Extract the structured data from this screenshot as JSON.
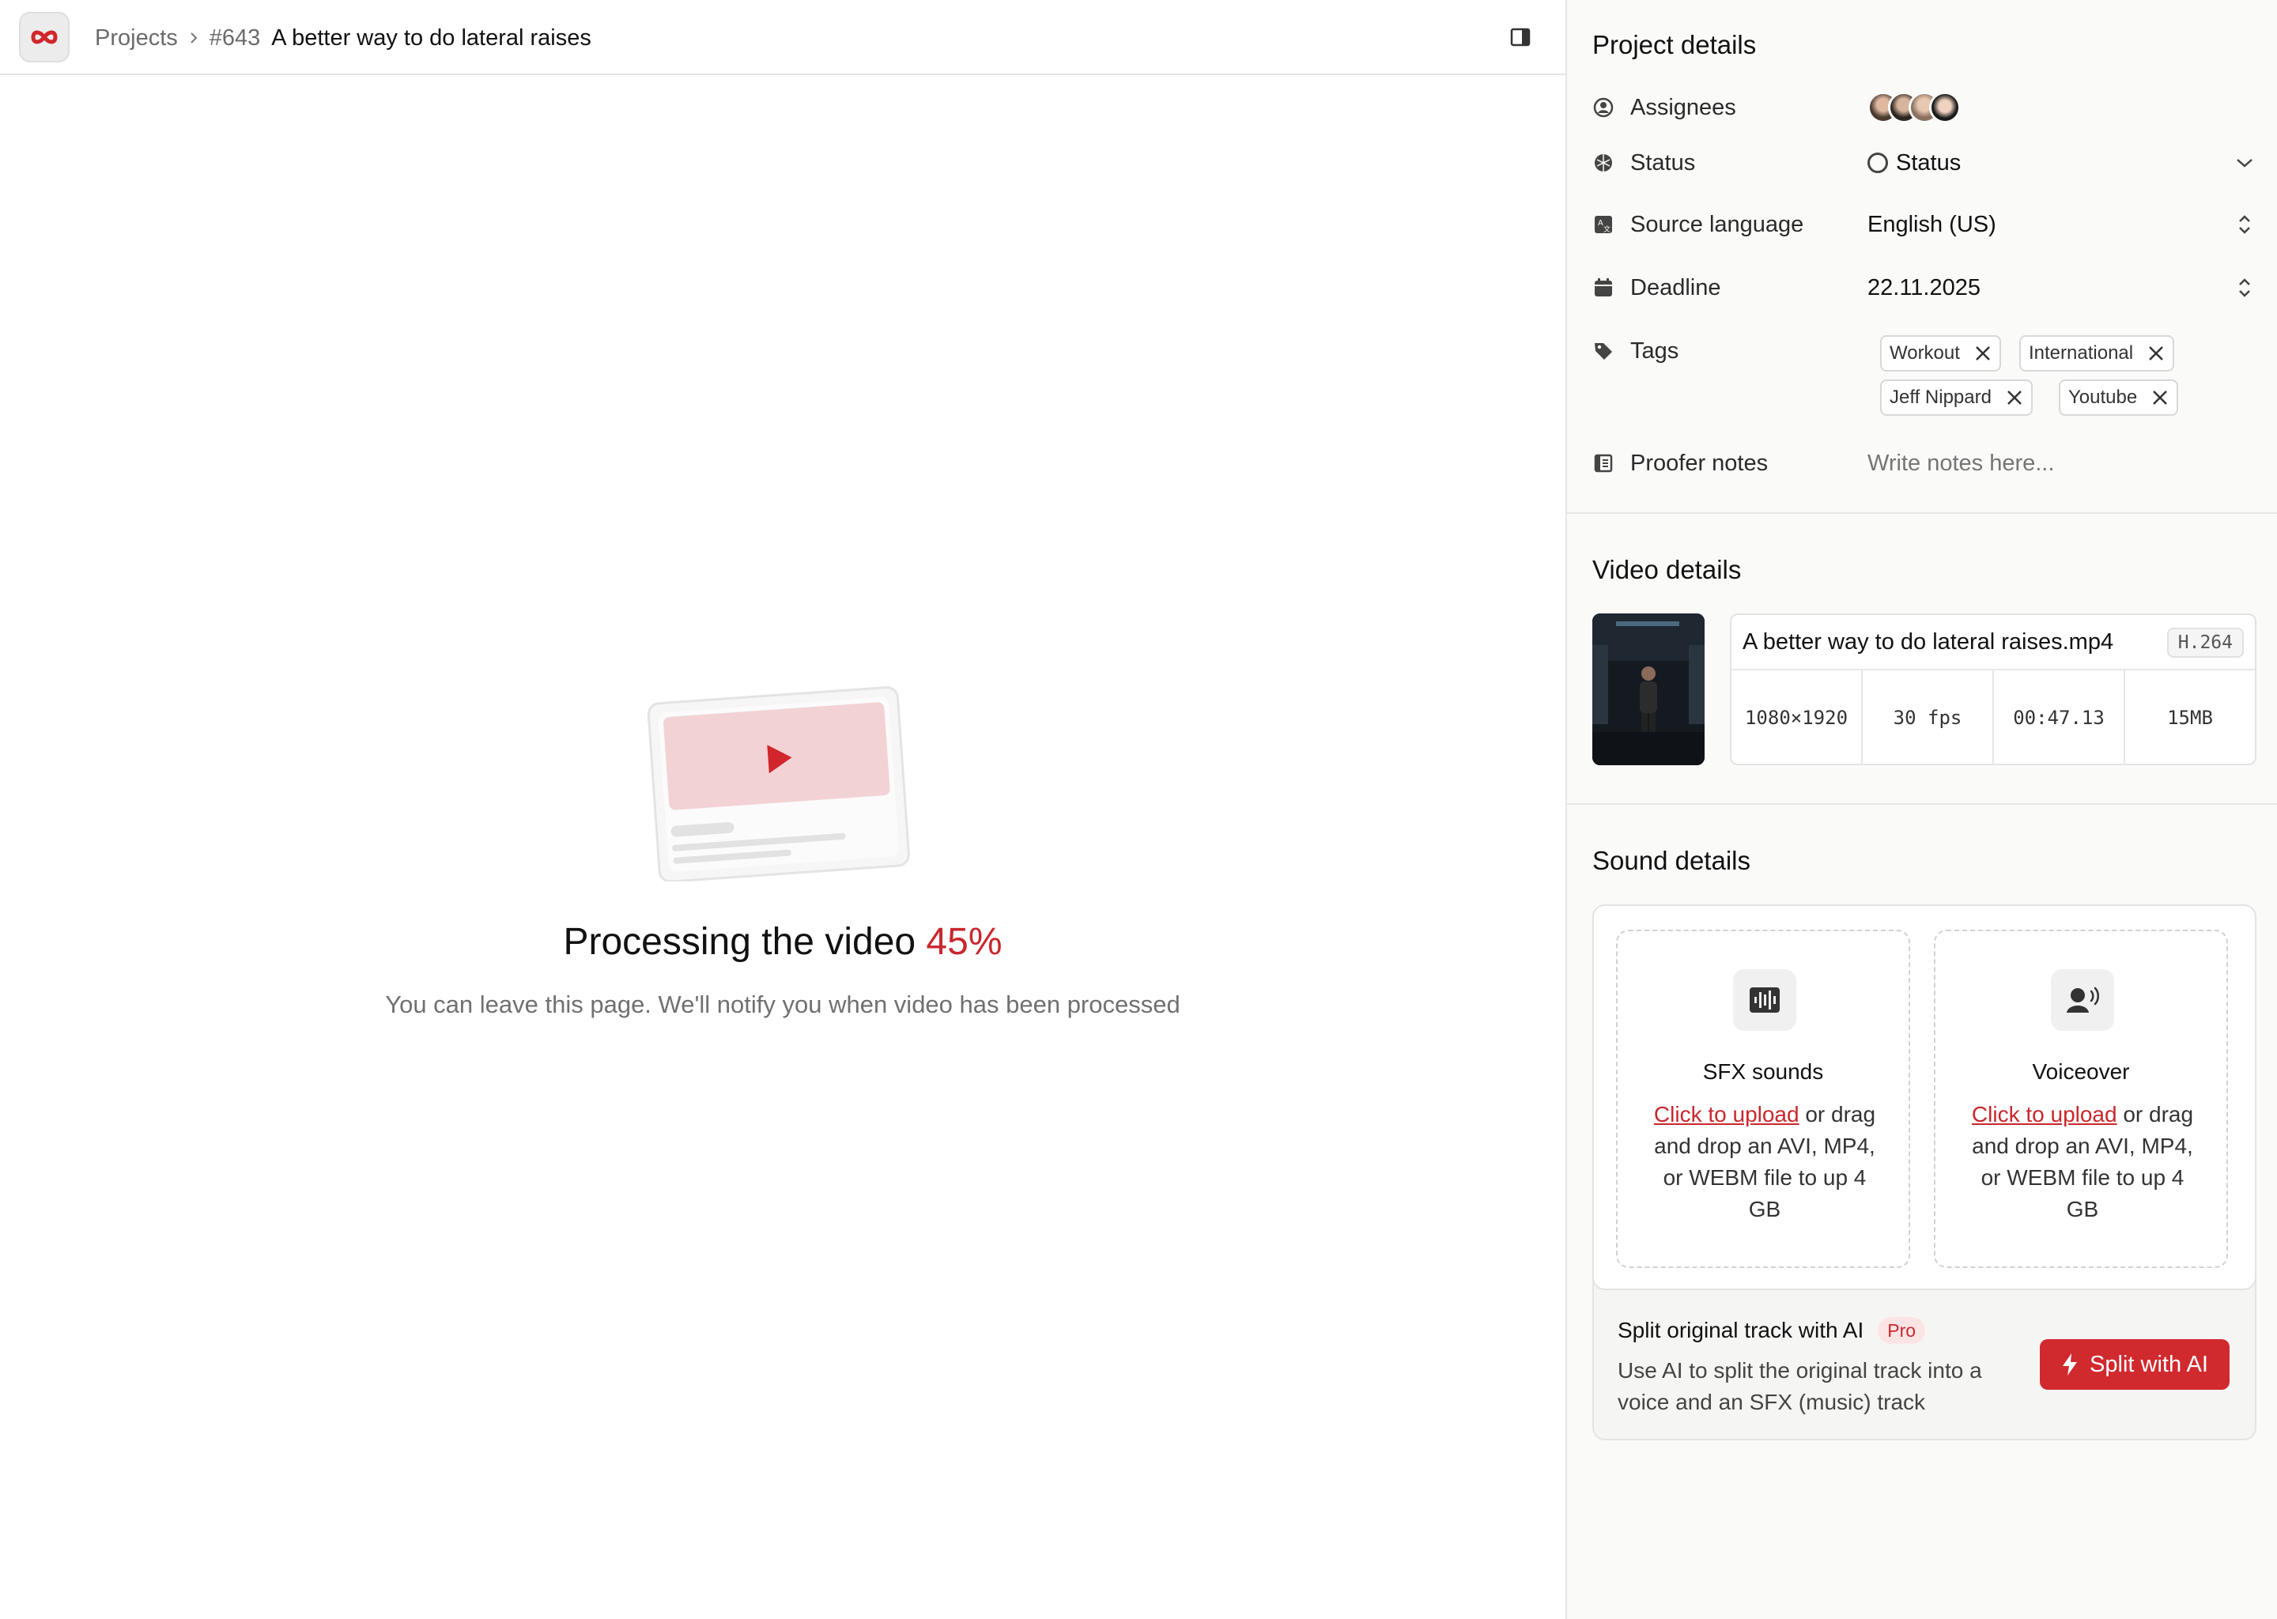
{
  "breadcrumb": {
    "projects": "Projects",
    "project_id": "#643",
    "project_title": "A better way to do lateral raises"
  },
  "processing": {
    "title": "Processing the video",
    "percent_label": "45%",
    "percent": 45,
    "subtitle": "You can leave this page. We'll notify you when video has been processed"
  },
  "project_details": {
    "title": "Project details",
    "assignees_label": "Assignees",
    "status_label": "Status",
    "status_value": "Status",
    "source_language_label": "Source language",
    "source_language_value": "English (US)",
    "deadline_label": "Deadline",
    "deadline_value": "22.11.2025",
    "tags_label": "Tags",
    "tags": [
      "Workout",
      "International",
      "Jeff Nippard",
      "Youtube"
    ],
    "proofer_notes_label": "Proofer notes",
    "proofer_notes_placeholder": "Write notes here..."
  },
  "video_details": {
    "title": "Video details",
    "file_name": "A better way to do lateral raises.mp4",
    "codec": "H.264",
    "resolution": "1080×1920",
    "fps": "30 fps",
    "duration": "00:47.13",
    "size": "15MB"
  },
  "sound_details": {
    "title": "Sound details",
    "sfx": {
      "title": "SFX sounds",
      "link": "Click to upload",
      "text": " or drag and drop an AVI, MP4, or WEBM file to up 4 GB"
    },
    "voiceover": {
      "title": "Voiceover",
      "link": "Click to upload",
      "text": " or drag and drop an AVI, MP4, or WEBM file to up 4 GB"
    },
    "split": {
      "title": "Split original track with AI",
      "badge": "Pro",
      "description": "Use AI to split the original track into a voice and an SFX (music) track",
      "button_label": "Split with AI"
    }
  },
  "icons": {
    "logo": "logo-icon",
    "chevron": "chevron-right-icon",
    "panel": "sidebar-toggle-icon"
  },
  "colors": {
    "accent": "#c9272d",
    "pro_badge_bg": "#fde4e4"
  }
}
